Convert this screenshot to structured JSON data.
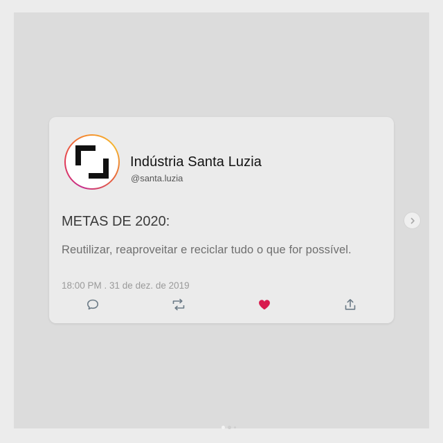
{
  "post": {
    "author_name": "Indústria Santa Luzia",
    "author_handle": "@santa.luzia",
    "heading": "METAS DE 2020:",
    "body": "Reutilizar, reaproveitar e reciclar tudo o que for possível.",
    "timestamp": "18:00 PM . 31 de dez. de 2019",
    "liked": true
  },
  "actions": [
    {
      "name": "reply",
      "icon": "comment-icon"
    },
    {
      "name": "retweet",
      "icon": "retweet-icon"
    },
    {
      "name": "like",
      "icon": "heart-icon",
      "color": "#d81b4e"
    },
    {
      "name": "share",
      "icon": "share-icon"
    }
  ],
  "carousel": {
    "next_icon": "chevron-right-icon",
    "page_count": 3,
    "active_page": 1
  },
  "colors": {
    "background": "#dcdcdc",
    "card": "#ebebeb",
    "like_active": "#d81b4e",
    "avatar_ring": [
      "#c62d8b",
      "#e23a55",
      "#f58a2b",
      "#f5b52e"
    ]
  }
}
